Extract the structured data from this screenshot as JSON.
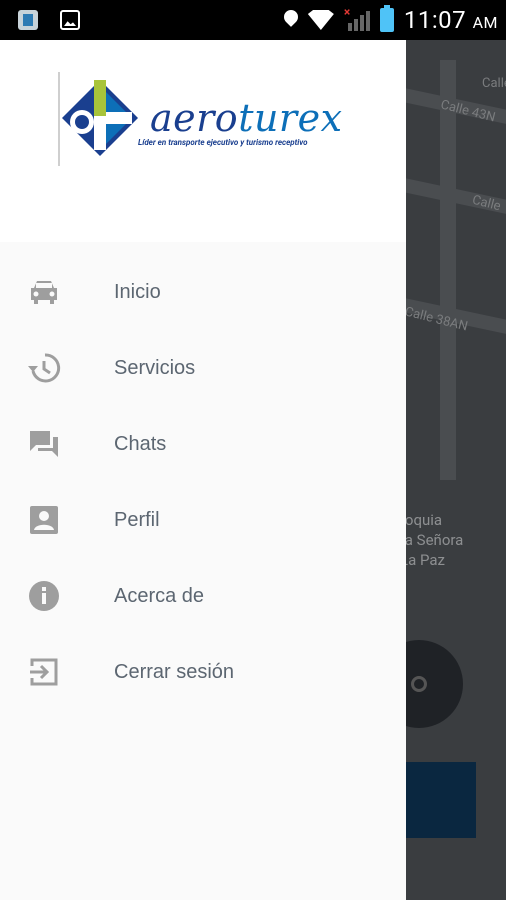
{
  "status_bar": {
    "time": "11:07",
    "ampm": "AM"
  },
  "map": {
    "streets": [
      "Calle",
      "Calle 43N",
      "Calle",
      "Calle 38AN"
    ],
    "place_lines": [
      "roquia",
      "ra Señora",
      "La Paz"
    ]
  },
  "drawer": {
    "logo": {
      "brand_a": "aero",
      "brand_b": "turex",
      "tagline": "Líder en transporte ejecutivo y turismo receptivo"
    },
    "items": [
      {
        "label": "Inicio",
        "icon": "taxi-icon"
      },
      {
        "label": "Servicios",
        "icon": "history-icon"
      },
      {
        "label": "Chats",
        "icon": "chat-icon"
      },
      {
        "label": "Perfil",
        "icon": "profile-icon"
      },
      {
        "label": "Acerca de",
        "icon": "info-icon"
      },
      {
        "label": "Cerrar sesión",
        "icon": "logout-icon"
      }
    ]
  },
  "colors": {
    "icon_gray": "#9e9e9e",
    "label": "#5c6671",
    "brand_blue": "#1a3f8f"
  }
}
